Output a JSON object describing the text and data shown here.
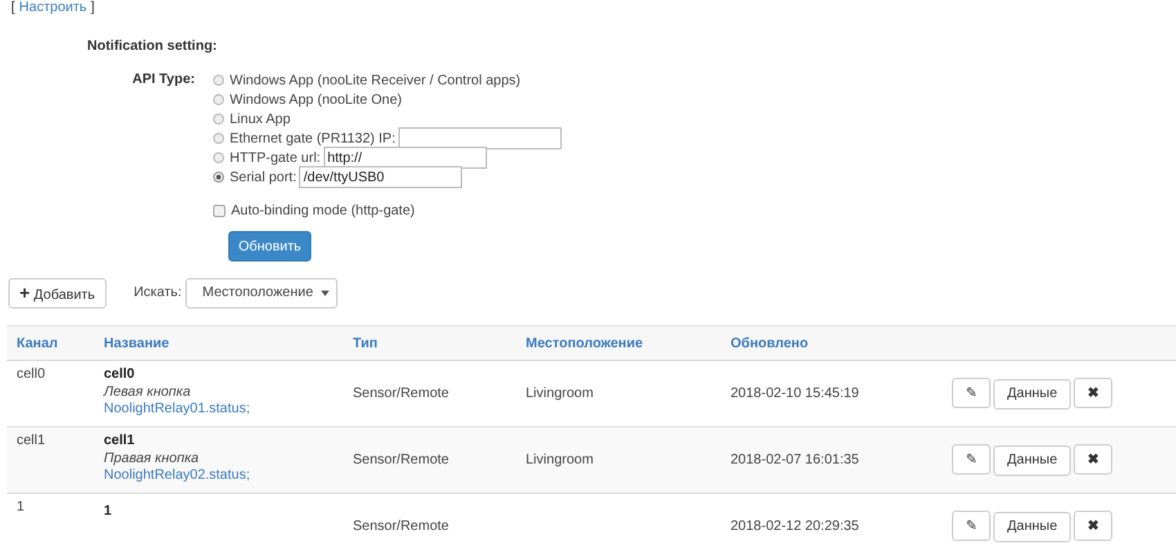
{
  "configure_link": {
    "open": "[",
    "label": "Настроить",
    "close": "]"
  },
  "notification_setting": {
    "title": "Notification setting:",
    "api_type": {
      "label": "API Type:",
      "options": [
        {
          "label": "Windows App (nooLite Receiver / Control apps)",
          "selected": false,
          "kind": "plain"
        },
        {
          "label": "Windows App (nooLite One)",
          "selected": false,
          "kind": "plain"
        },
        {
          "label": "Linux App",
          "selected": false,
          "kind": "plain"
        },
        {
          "label": "Ethernet gate (PR1132) IP:",
          "selected": false,
          "kind": "input"
        },
        {
          "label": "HTTP-gate url:",
          "selected": false,
          "kind": "input",
          "value": "http://"
        },
        {
          "label": "Serial port:",
          "selected": true,
          "kind": "input",
          "value": "/dev/ttyUSB0"
        }
      ]
    },
    "auto_binding": {
      "label": "Auto-binding mode (http-gate)",
      "checked": false
    },
    "update_button": "Обновить"
  },
  "toolbar": {
    "add_button": {
      "icon": "+",
      "label": "Добавить"
    },
    "search_label": "Искать:",
    "search_select": "Местоположение"
  },
  "table": {
    "columns": [
      "Канал",
      "Название",
      "Тип",
      "Местоположение",
      "Обновлено"
    ],
    "rows": [
      {
        "channel": "cell0",
        "name": "cell0",
        "description": "Левая кнопка",
        "script": "NoolightRelay01.status;",
        "type": "Sensor/Remote",
        "location": "Livingroom",
        "updated": "2018-02-10 15:45:19",
        "actions": {
          "edit": "✎",
          "data": "Данные",
          "delete": "✖"
        }
      },
      {
        "channel": "cell1",
        "name": "cell1",
        "description": "Правая кнопка",
        "script": "NoolightRelay02.status;",
        "type": "Sensor/Remote",
        "location": "Livingroom",
        "updated": "2018-02-07 16:01:35",
        "actions": {
          "edit": "✎",
          "data": "Данные",
          "delete": "✖"
        }
      },
      {
        "channel": "1",
        "name": "1",
        "type": "Sensor/Remote",
        "updated": "2018-02-12 20:29:35",
        "actions": {
          "edit": "✎",
          "data": "Данные",
          "delete": "✖"
        }
      }
    ]
  }
}
